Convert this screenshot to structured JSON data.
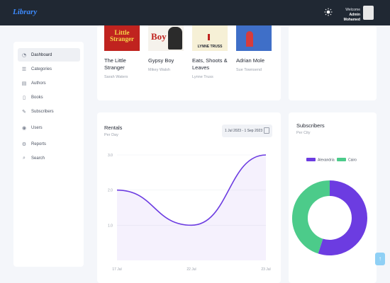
{
  "header": {
    "brand": "Library",
    "welcome": "Welcome",
    "user_name": "Admin Mohamed"
  },
  "sidebar": {
    "items": [
      {
        "label": "Dashboard",
        "icon": "dashboard-icon",
        "active": true
      },
      {
        "label": "Categories",
        "icon": "categories-icon"
      },
      {
        "label": "Authors",
        "icon": "authors-icon"
      },
      {
        "label": "Books",
        "icon": "books-icon"
      },
      {
        "label": "Subscribers",
        "icon": "subscribers-icon"
      },
      {
        "label": "Users",
        "icon": "users-icon"
      },
      {
        "label": "Reports",
        "icon": "reports-icon"
      },
      {
        "label": "Search",
        "icon": "search-icon"
      }
    ]
  },
  "books": [
    {
      "title": "The Little Stranger",
      "author": "Sarah Waters",
      "cover_text": "Little Stranger",
      "cover_color": "#c0231f"
    },
    {
      "title": "Gypsy Boy",
      "author": "Mikey Walsh",
      "cover_text": "Boy",
      "cover_color": "#f5f2ec"
    },
    {
      "title": "Eats, Shoots & Leaves",
      "author": "Lynne Truss",
      "cover_text": "LYNNE TRUSS",
      "cover_color": "#f6f0d6"
    },
    {
      "title": "Adrian Mole",
      "author": "Sue Townsend",
      "cover_text": "",
      "cover_color": "#3f6fc8"
    }
  ],
  "rentals": {
    "title": "Rentals",
    "subtitle": "Per Day",
    "date_range": "1 Jul 2023 - 1 Sep 2023"
  },
  "subscribers": {
    "title": "Subscribers",
    "subtitle": "Per City"
  },
  "chart_data": [
    {
      "type": "area",
      "x": [
        "17 Jul",
        "22 Jul",
        "23 Jul"
      ],
      "series": [
        {
          "values": [
            2.0,
            1.0,
            3.0
          ]
        }
      ],
      "yticks": [
        1.0,
        2.0,
        3.0
      ],
      "ylim": [
        0,
        3.0
      ],
      "color": "#6c3ce1"
    },
    {
      "type": "pie",
      "labels": [
        "Alexandria",
        "Cairo"
      ],
      "values": [
        55,
        45
      ],
      "colors": [
        "#6c3ce1",
        "#4ccb8a"
      ],
      "legend": "top"
    }
  ]
}
